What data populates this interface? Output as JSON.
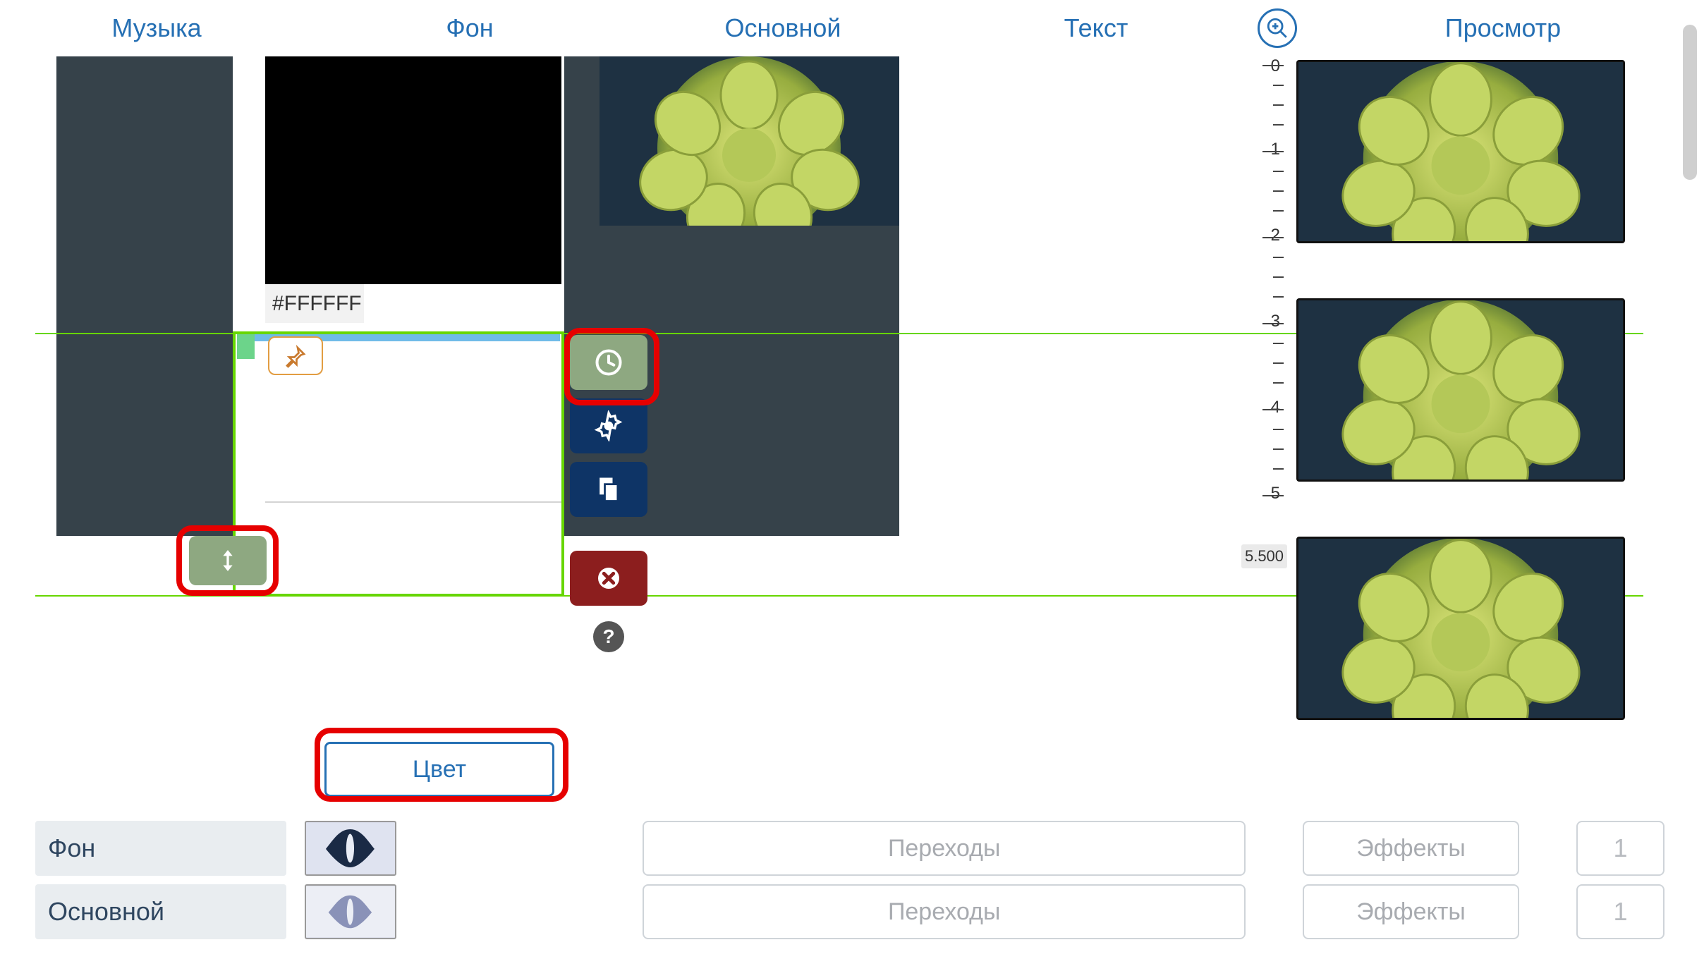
{
  "tabs": {
    "music": "Музыка",
    "background": "Фон",
    "main": "Основной",
    "text": "Текст",
    "preview": "Просмотр"
  },
  "color_field": "#FFFFFF",
  "ruler": {
    "ticks": [
      "0",
      "1",
      "2",
      "3",
      "4",
      "5"
    ],
    "end": "5.500"
  },
  "color_button": "Цвет",
  "layers": [
    {
      "label": "Фон",
      "transitions": "Переходы",
      "effects": "Эффекты",
      "count": "1"
    },
    {
      "label": "Основной",
      "transitions": "Переходы",
      "effects": "Эффекты",
      "count": "1"
    }
  ]
}
